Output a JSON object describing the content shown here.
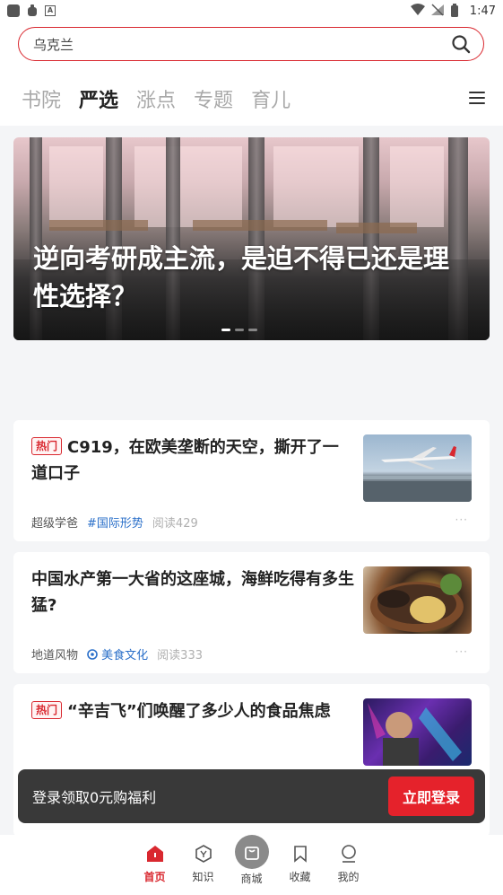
{
  "status_bar": {
    "time": "1:47"
  },
  "search": {
    "query": "乌克兰"
  },
  "tabs": [
    {
      "label": "书院",
      "active": false
    },
    {
      "label": "严选",
      "active": true
    },
    {
      "label": "涨点",
      "active": false
    },
    {
      "label": "专题",
      "active": false
    },
    {
      "label": "育儿",
      "active": false
    }
  ],
  "banner": {
    "title": "逆向考研成主流，是迫不得已还是理性选择？"
  },
  "articles": [
    {
      "hot": "热门",
      "title": "C919，在欧美垄断的天空，撕开了一道口子",
      "author": "超级学爸",
      "tag": "#国际形势",
      "reads": "阅读429"
    },
    {
      "hot": "",
      "title": "中国水产第一大省的这座城，海鲜吃得有多生猛?",
      "author": "地道风物",
      "tag": "美食文化",
      "reads": "阅读333"
    },
    {
      "hot": "热门",
      "title": "“辛吉飞”们唤醒了多少人的食品焦虑",
      "author": "",
      "tag": "",
      "reads": ""
    }
  ],
  "login_toast": {
    "text": "登录领取0元购福利",
    "button": "立即登录"
  },
  "bottom_nav": [
    {
      "label": "首页",
      "icon": "home-icon",
      "active": true
    },
    {
      "label": "知识",
      "icon": "knowledge-icon",
      "active": false
    },
    {
      "label": "商城",
      "icon": "mall-icon",
      "active": false
    },
    {
      "label": "收藏",
      "icon": "bookmark-icon",
      "active": false
    },
    {
      "label": "我的",
      "icon": "profile-icon",
      "active": false
    }
  ],
  "colors": {
    "accent": "#d9282f",
    "tag_blue": "#2a6fc9",
    "toast_bg": "#282828"
  }
}
